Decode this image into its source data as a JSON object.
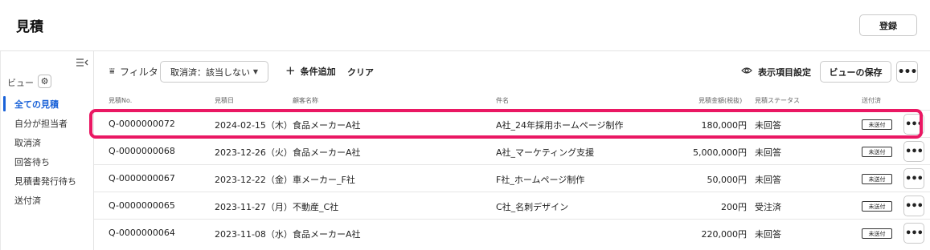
{
  "header": {
    "title": "見積",
    "register_label": "登録"
  },
  "sidebar": {
    "view_label": "ビュー",
    "items": [
      {
        "label": "全ての見積",
        "active": true
      },
      {
        "label": "自分が担当者",
        "active": false
      },
      {
        "label": "取消済",
        "active": false
      },
      {
        "label": "回答待ち",
        "active": false
      },
      {
        "label": "見積書発行待ち",
        "active": false
      },
      {
        "label": "送付済",
        "active": false
      }
    ]
  },
  "toolbar": {
    "filter_label": "フィルタ",
    "filter_select_value": "取消済：該当しない",
    "add_condition_label": "条件追加",
    "clear_label": "クリア",
    "column_settings_label": "表示項目設定",
    "save_view_label": "ビューの保存"
  },
  "table": {
    "columns": [
      "見積No.",
      "見積日",
      "顧客名称",
      "件名",
      "見積金額(税抜)",
      "見積ステータス",
      "送付済"
    ],
    "rows": [
      {
        "no": "Q-0000000072",
        "date": "2024-02-15（木）",
        "customer": "食品メーカーA社",
        "subject": "A社_24年採用ホームページ制作",
        "amount": "180,000円",
        "status": "未回答",
        "sent": "未送付"
      },
      {
        "no": "Q-0000000068",
        "date": "2023-12-26（火）",
        "customer": "食品メーカーA社",
        "subject": "A社_マーケティング支援",
        "amount": "5,000,000円",
        "status": "未回答",
        "sent": "未送付"
      },
      {
        "no": "Q-0000000067",
        "date": "2023-12-22（金）",
        "customer": "車メーカー_F社",
        "subject": "F社_ホームページ制作",
        "amount": "50,000円",
        "status": "未回答",
        "sent": "未送付"
      },
      {
        "no": "Q-0000000065",
        "date": "2023-11-27（月）",
        "customer": "不動産_C社",
        "subject": "C社_名刺デザイン",
        "amount": "200円",
        "status": "受注済",
        "sent": "未送付"
      },
      {
        "no": "Q-0000000064",
        "date": "2023-11-08（水）",
        "customer": "食品メーカーA社",
        "subject": "",
        "amount": "220,000円",
        "status": "未回答",
        "sent": "未送付"
      }
    ]
  },
  "colors": {
    "accent": "#1a62d8",
    "highlight": "#ea1763"
  }
}
